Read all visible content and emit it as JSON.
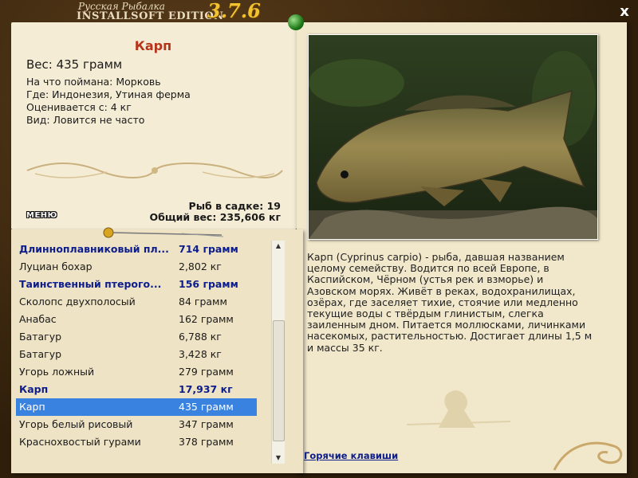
{
  "window": {
    "logo_line1": "Русская Рыбалка",
    "logo_line2": "INSTALLSOFT EDITION",
    "version": "3.7.6",
    "close_label": "x"
  },
  "fish": {
    "name": "Карп",
    "weight": "Вес: 435 грамм",
    "bait": "На что поймана: Морковь",
    "location": "Где: Индонезия, Утиная ферма",
    "rated_from": "Оценивается с: 4 кг",
    "rarity": "Вид: Ловится не часто",
    "description": "Карп (Cyprinus carpio) - рыба, давшая названием целому семейству. Водится по всей Европе, в Каспийском, Чёрном (устья рек и взморье) и Азовском морях. Живёт в реках, водохранилищах, озёрах, где заселяет тихие, стоячие или медленно текущие воды с твёрдым глинистым, слегка заиленным дном. Питается моллюсками, личинками насекомых, растительностью. Достигает длины 1,5 м и массы 35 кг."
  },
  "stats": {
    "fish_in_net": "Рыб в садке: 19",
    "total_weight": "Общий вес: 235,606 кг"
  },
  "menu_label": "МЕНЮ",
  "hotkeys_label": "Горячие клавиши",
  "catch_list": [
    {
      "name": "Длинноплавниковый пл...",
      "weight": "714 грамм",
      "bold": true,
      "selected": false
    },
    {
      "name": "Луциан бохар",
      "weight": "2,802 кг",
      "bold": false,
      "selected": false
    },
    {
      "name": "Таинственный птерого...",
      "weight": "156 грамм",
      "bold": true,
      "selected": false
    },
    {
      "name": "Сколопс двухполосый",
      "weight": "84 грамм",
      "bold": false,
      "selected": false
    },
    {
      "name": "Анабас",
      "weight": "162 грамм",
      "bold": false,
      "selected": false
    },
    {
      "name": "Батагур",
      "weight": "6,788 кг",
      "bold": false,
      "selected": false
    },
    {
      "name": "Батагур",
      "weight": "3,428 кг",
      "bold": false,
      "selected": false
    },
    {
      "name": "Угорь ложный",
      "weight": "279 грамм",
      "bold": false,
      "selected": false
    },
    {
      "name": "Карп",
      "weight": "17,937 кг",
      "bold": true,
      "selected": false
    },
    {
      "name": "Карп",
      "weight": "435 грамм",
      "bold": false,
      "selected": true
    },
    {
      "name": "Угорь белый рисовый",
      "weight": "347 грамм",
      "bold": false,
      "selected": false
    },
    {
      "name": "Краснохвостый гурами",
      "weight": "378 грамм",
      "bold": false,
      "selected": false
    }
  ],
  "colors": {
    "title_red": "#b5341a",
    "highlight_blue": "#0d1e8c",
    "selection": "#3a82e0",
    "version_gold": "#f2c230"
  }
}
